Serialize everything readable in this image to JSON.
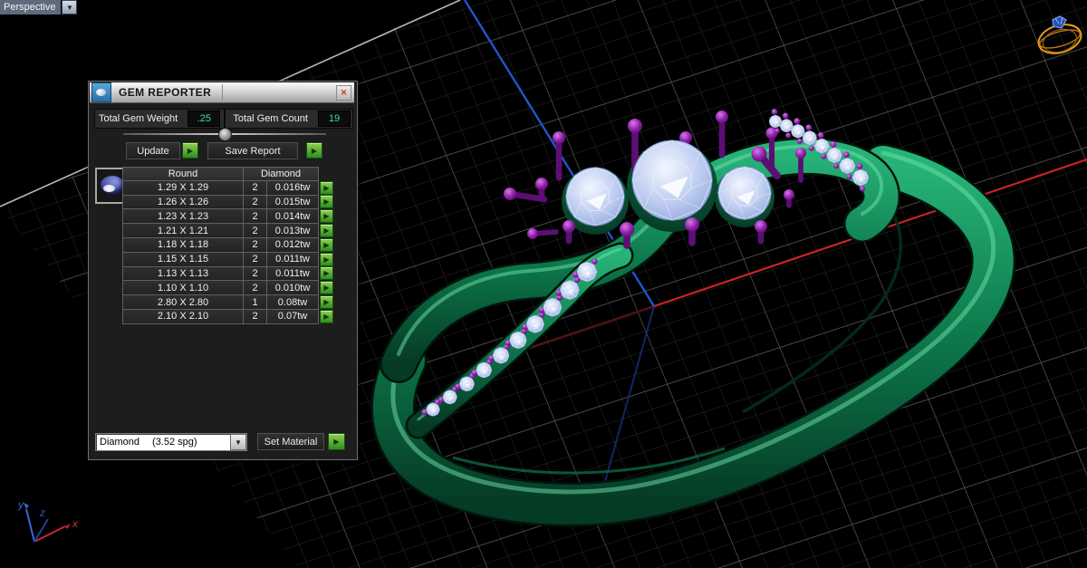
{
  "viewport": {
    "label": "Perspective",
    "dropdown_glyph": "▼"
  },
  "gizmo": {
    "x_label": "x",
    "y_label": "y",
    "z_label": "z"
  },
  "panel": {
    "title": "GEM REPORTER",
    "close_glyph": "✕",
    "weight_label": "Total Gem Weight",
    "weight_value": ".25",
    "count_label": "Total Gem Count",
    "count_value": "19",
    "update_label": "Update",
    "save_label": "Save Report",
    "arrow_glyph": "▶",
    "table": {
      "col1_header": "Round",
      "col2_header": "Diamond",
      "rows": [
        [
          "1.29 X 1.29",
          "2",
          "0.016tw"
        ],
        [
          "1.26 X 1.26",
          "2",
          "0.015tw"
        ],
        [
          "1.23 X 1.23",
          "2",
          "0.014tw"
        ],
        [
          "1.21 X 1.21",
          "2",
          "0.013tw"
        ],
        [
          "1.18 X 1.18",
          "2",
          "0.012tw"
        ],
        [
          "1.15 X 1.15",
          "2",
          "0.011tw"
        ],
        [
          "1.13 X 1.13",
          "2",
          "0.011tw"
        ],
        [
          "1.10 X 1.10",
          "2",
          "0.010tw"
        ],
        [
          "2.80 X 2.80",
          "1",
          "0.08tw"
        ],
        [
          "2.10 X 2.10",
          "2",
          "0.07tw"
        ]
      ]
    },
    "material_name": "Diamond",
    "material_density": "(3.52 spg)",
    "set_material_label": "Set Material"
  },
  "colors": {
    "value_teal": "#35dcb9",
    "button_green": "#4db32a",
    "ring_green": "#0d7a4c",
    "gem_blue": "#b9c8ee",
    "prong_purple": "#8a1ca6",
    "axis_red": "#cc2222",
    "axis_blue": "#2255cc",
    "grid_minor": "#2a2a2a",
    "grid_major": "#585858"
  }
}
